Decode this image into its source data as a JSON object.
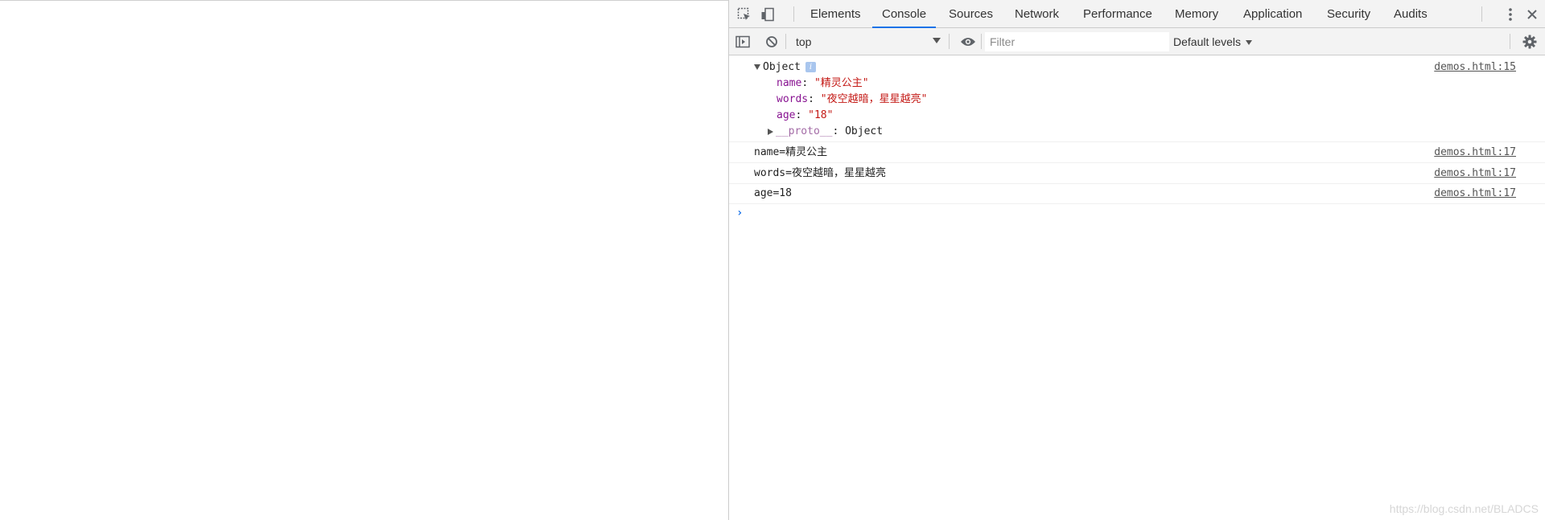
{
  "tabs": [
    {
      "label": "Elements",
      "active": false
    },
    {
      "label": "Console",
      "active": true
    },
    {
      "label": "Sources",
      "active": false
    },
    {
      "label": "Network",
      "active": false
    },
    {
      "label": "Performance",
      "active": false
    },
    {
      "label": "Memory",
      "active": false
    },
    {
      "label": "Application",
      "active": false
    },
    {
      "label": "Security",
      "active": false
    },
    {
      "label": "Audits",
      "active": false
    }
  ],
  "toolbar": {
    "context": "top",
    "filter_placeholder": "Filter",
    "levels_label": "Default levels"
  },
  "console": {
    "object_entry": {
      "label": "Object",
      "info_badge": "i",
      "properties": [
        {
          "key": "name",
          "value": "\"精灵公主\""
        },
        {
          "key": "words",
          "value": "\"夜空越暗，星星越亮\""
        },
        {
          "key": "age",
          "value": "\"18\""
        }
      ],
      "proto_key": "__proto__",
      "proto_value": ": Object",
      "source": "demos.html:15"
    },
    "log_lines": [
      {
        "text": "name=精灵公主",
        "source": "demos.html:17"
      },
      {
        "text": "words=夜空越暗，星星越亮",
        "source": "demos.html:17"
      },
      {
        "text": "age=18",
        "source": "demos.html:17"
      }
    ],
    "prompt_symbol": "›"
  },
  "watermark": "https://blog.csdn.net/BLADCS",
  "colors": {
    "accent": "#1a73e8",
    "string": "#c41a16",
    "property_key": "#881391",
    "toolbar_bg": "#f3f3f3"
  }
}
